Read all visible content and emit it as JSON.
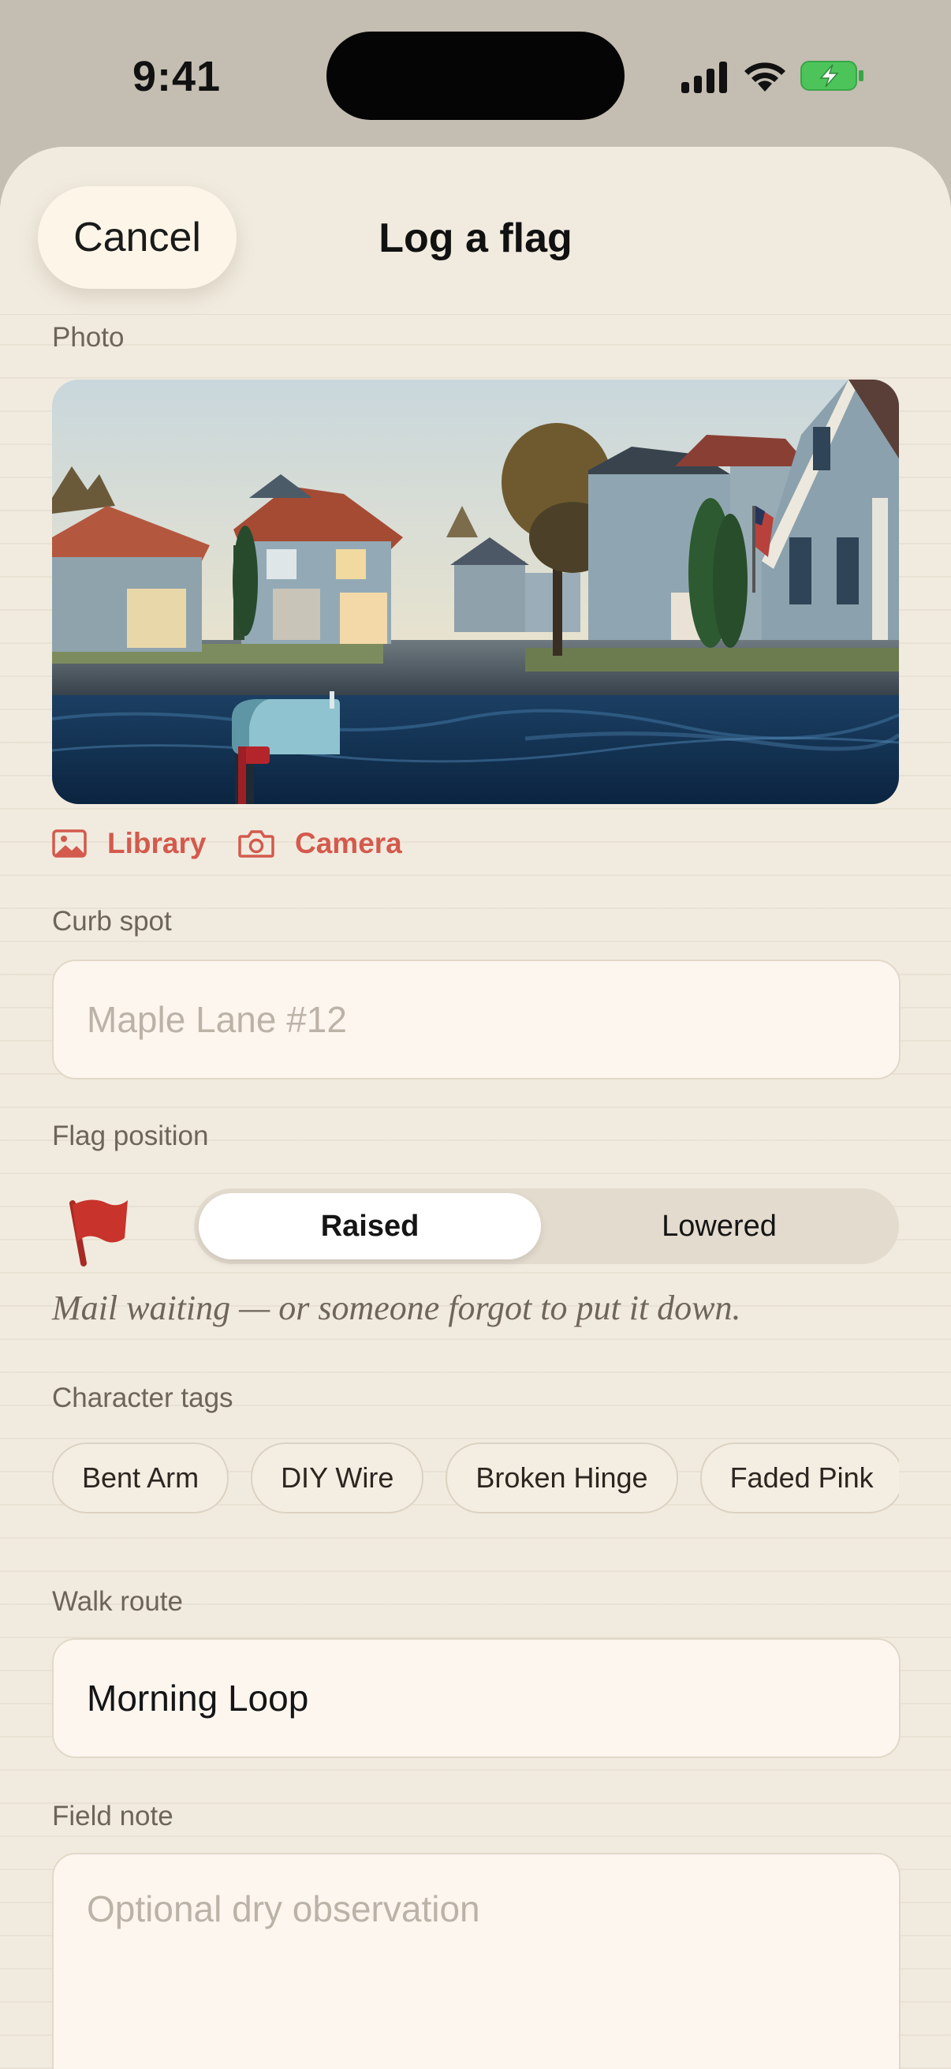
{
  "status_bar": {
    "time": "9:41"
  },
  "header": {
    "cancel_label": "Cancel",
    "title": "Log a flag"
  },
  "photo": {
    "label": "Photo",
    "library_label": "Library",
    "camera_label": "Camera"
  },
  "curb_spot": {
    "label": "Curb spot",
    "placeholder": "Maple Lane #12",
    "value": ""
  },
  "flag_position": {
    "label": "Flag position",
    "options": [
      "Raised",
      "Lowered"
    ],
    "selected": "Raised",
    "description": "Mail waiting — or someone forgot to put it down."
  },
  "character_tags": {
    "label": "Character tags",
    "items": [
      "Bent Arm",
      "DIY Wire",
      "Broken Hinge",
      "Faded Pink"
    ]
  },
  "walk_route": {
    "label": "Walk route",
    "value": "Morning Loop"
  },
  "field_note": {
    "label": "Field note",
    "placeholder": "Optional dry observation",
    "value": ""
  },
  "colors": {
    "accent": "#d35a4d",
    "sheet": "#f1ebdf",
    "flag_red": "#c8332b"
  },
  "icons": [
    "signal-icon",
    "wifi-icon",
    "battery-charging-icon",
    "image-icon",
    "camera-icon",
    "flag-icon"
  ]
}
